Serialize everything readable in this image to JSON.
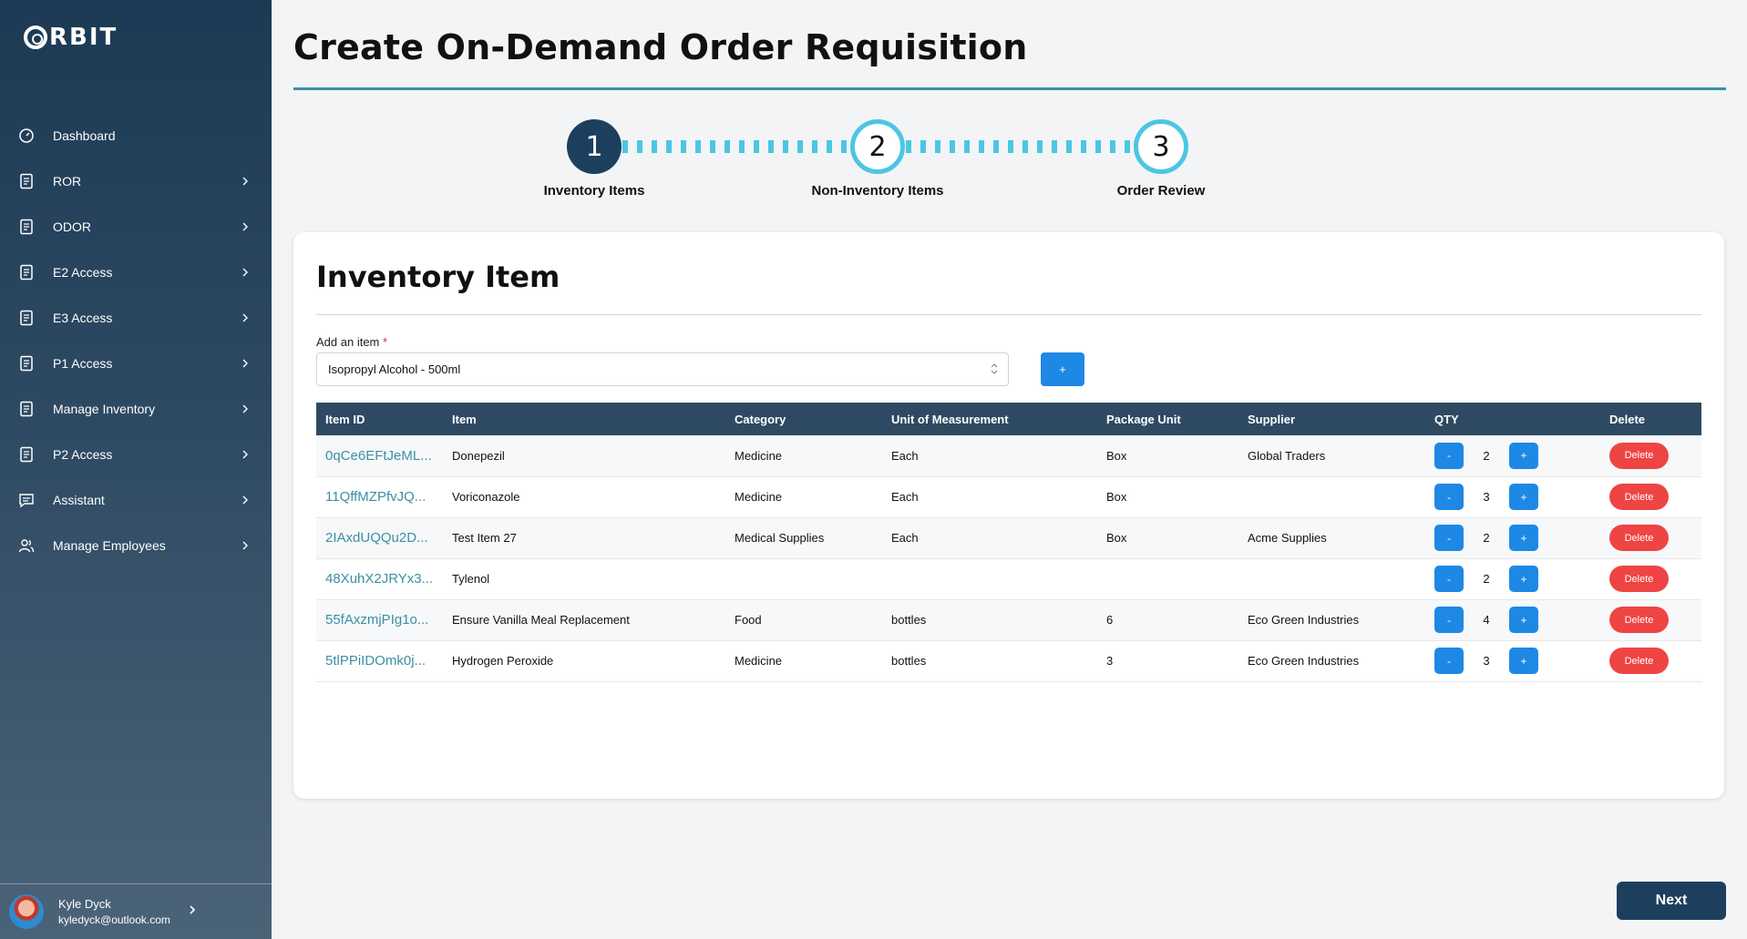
{
  "app": {
    "logo_text": "RBIT",
    "logo_icon": "orbit-logo-icon"
  },
  "sidebar": {
    "items": [
      {
        "label": "Dashboard",
        "icon": "gauge-icon",
        "has_chevron": false
      },
      {
        "label": "ROR",
        "icon": "document-icon",
        "has_chevron": true
      },
      {
        "label": "ODOR",
        "icon": "document-icon",
        "has_chevron": true
      },
      {
        "label": "E2 Access",
        "icon": "document-icon",
        "has_chevron": true
      },
      {
        "label": "E3 Access",
        "icon": "document-icon",
        "has_chevron": true
      },
      {
        "label": "P1 Access",
        "icon": "document-icon",
        "has_chevron": true
      },
      {
        "label": "Manage Inventory",
        "icon": "document-icon",
        "has_chevron": true
      },
      {
        "label": "P2 Access",
        "icon": "document-icon",
        "has_chevron": true
      },
      {
        "label": "Assistant",
        "icon": "chat-icon",
        "has_chevron": true
      },
      {
        "label": "Manage Employees",
        "icon": "users-icon",
        "has_chevron": true
      }
    ],
    "profile": {
      "name": "Kyle Dyck",
      "email": "kyledyck@outlook.com"
    }
  },
  "page": {
    "title": "Create On-Demand Order Requisition"
  },
  "stepper": {
    "steps": [
      {
        "number": "1",
        "label": "Inventory Items",
        "state": "active"
      },
      {
        "number": "2",
        "label": "Non-Inventory Items",
        "state": "pending"
      },
      {
        "number": "3",
        "label": "Order Review",
        "state": "pending"
      }
    ]
  },
  "card": {
    "title": "Inventory Item",
    "add_label": "Add an item",
    "required_mark": "*",
    "selected_item": "Isopropyl Alcohol - 500ml",
    "add_button": "+"
  },
  "table": {
    "headers": [
      "Item ID",
      "Item",
      "Category",
      "Unit of Measurement",
      "Package Unit",
      "Supplier",
      "QTY",
      "Delete"
    ],
    "rows": [
      {
        "id": "0qCe6EFtJeML...",
        "item": "Donepezil",
        "category": "Medicine",
        "uom": "Each",
        "package": "Box",
        "supplier": "Global Traders",
        "qty": "2"
      },
      {
        "id": "11QffMZPfvJQ...",
        "item": "Voriconazole",
        "category": "Medicine",
        "uom": "Each",
        "package": "Box",
        "supplier": "",
        "qty": "3"
      },
      {
        "id": "2IAxdUQQu2D...",
        "item": "Test Item 27",
        "category": "Medical Supplies",
        "uom": "Each",
        "package": "Box",
        "supplier": "Acme Supplies",
        "qty": "2"
      },
      {
        "id": "48XuhX2JRYx3...",
        "item": "Tylenol",
        "category": "",
        "uom": "",
        "package": "",
        "supplier": "",
        "qty": "2"
      },
      {
        "id": "55fAxzmjPIg1o...",
        "item": "Ensure Vanilla Meal Replacement",
        "category": "Food",
        "uom": "bottles",
        "package": "6",
        "supplier": "Eco Green Industries",
        "qty": "4"
      },
      {
        "id": "5tlPPiIDOmk0j...",
        "item": "Hydrogen Peroxide",
        "category": "Medicine",
        "uom": "bottles",
        "package": "3",
        "supplier": "Eco Green Industries",
        "qty": "3"
      }
    ],
    "minus_label": "-",
    "plus_label": "+",
    "delete_label": "Delete"
  },
  "footer": {
    "next_label": "Next"
  },
  "colors": {
    "sidebar": "#1d3a55",
    "accent": "#3a8fa3",
    "step_active": "#1d3f5e",
    "step_ring": "#4cc6e2",
    "primary_button": "#1e88e5",
    "danger": "#ef4444"
  }
}
